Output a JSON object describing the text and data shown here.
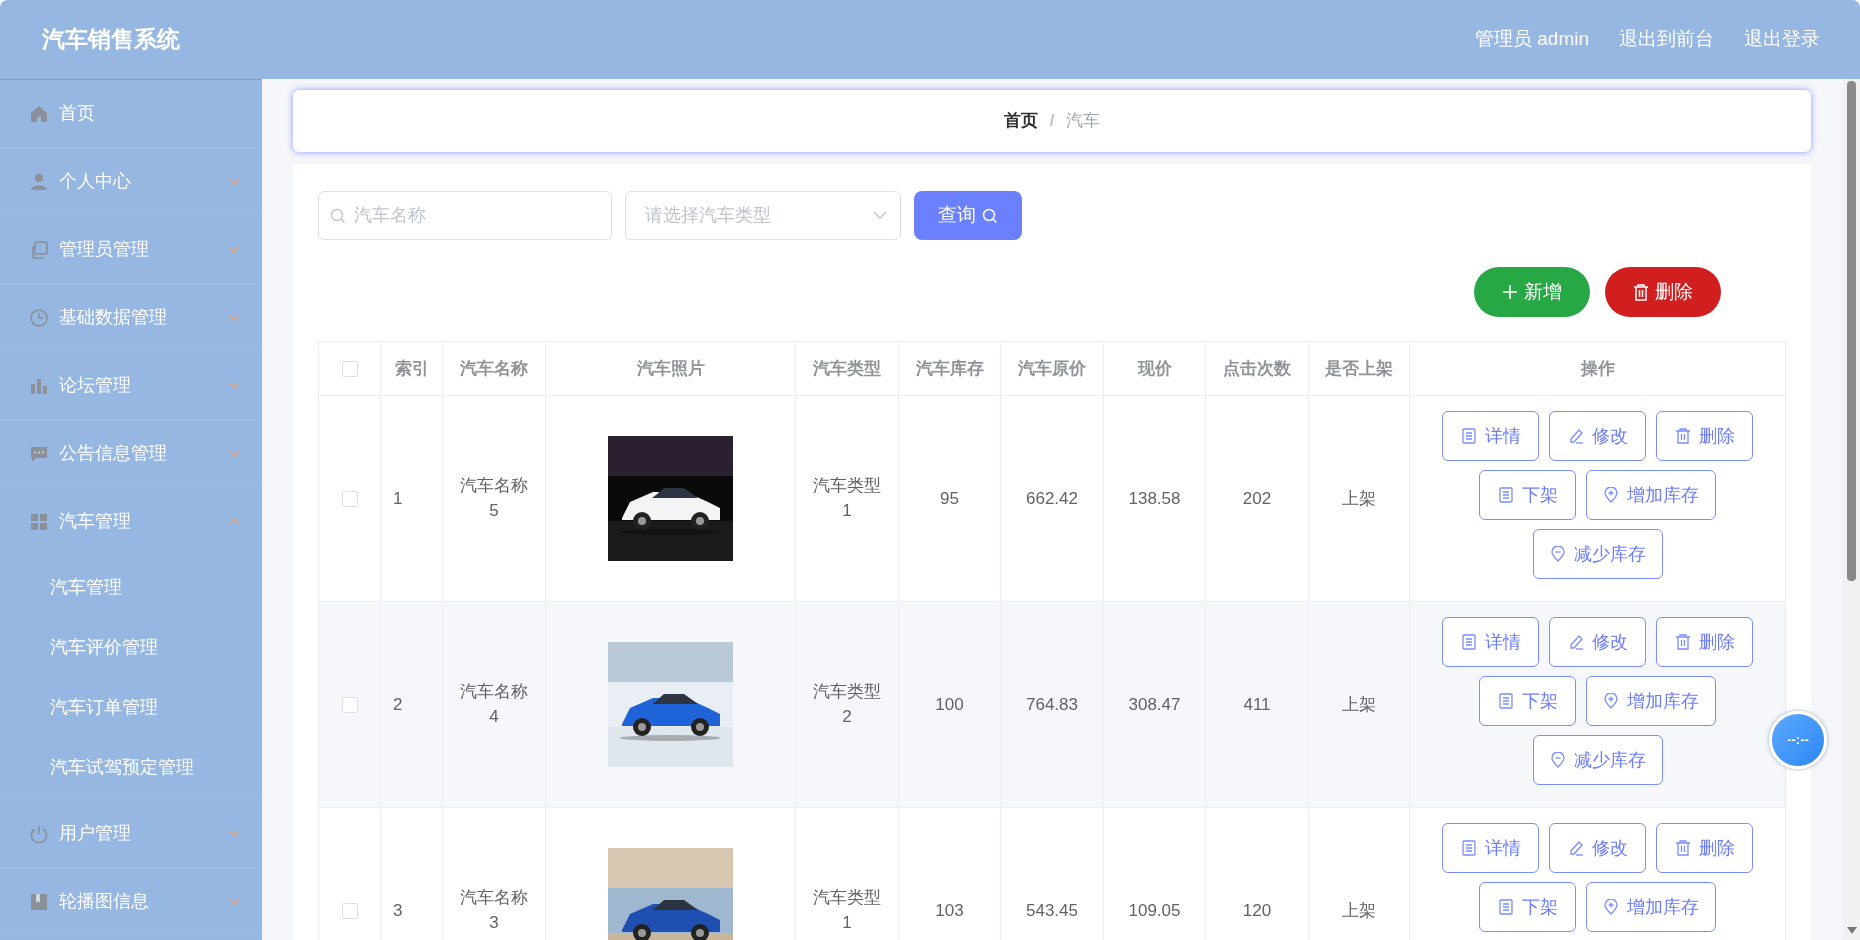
{
  "header": {
    "title": "汽车销售系统",
    "links": [
      "管理员 admin",
      "退出到前台",
      "退出登录"
    ]
  },
  "sidebar": {
    "items": [
      {
        "label": "首页",
        "kind": "link"
      },
      {
        "label": "个人中心",
        "kind": "group",
        "expanded": false
      },
      {
        "label": "管理员管理",
        "kind": "group",
        "expanded": false
      },
      {
        "label": "基础数据管理",
        "kind": "group",
        "expanded": false
      },
      {
        "label": "论坛管理",
        "kind": "group",
        "expanded": false
      },
      {
        "label": "公告信息管理",
        "kind": "group",
        "expanded": false
      },
      {
        "label": "汽车管理",
        "kind": "group",
        "expanded": true,
        "children": [
          {
            "label": "汽车管理"
          },
          {
            "label": "汽车评价管理"
          },
          {
            "label": "汽车订单管理"
          },
          {
            "label": "汽车试驾预定管理"
          }
        ]
      },
      {
        "label": "用户管理",
        "kind": "group",
        "expanded": false
      },
      {
        "label": "轮播图信息",
        "kind": "group",
        "expanded": false
      }
    ]
  },
  "breadcrumb": {
    "separator": "/",
    "items": [
      {
        "label": "首页"
      },
      {
        "label": "汽车"
      }
    ]
  },
  "search": {
    "name_placeholder": "汽车名称",
    "type_placeholder": "请选择汽车类型",
    "button": "查询"
  },
  "toolbar": [
    {
      "label": "新增",
      "kind": "add"
    },
    {
      "label": "删除",
      "kind": "delete"
    }
  ],
  "table": {
    "header_checked": false,
    "columns": [
      "索引",
      "汽车名称",
      "汽车照片",
      "汽车类型",
      "汽车库存",
      "汽车原价",
      "现价",
      "点击次数",
      "是否上架",
      "操作"
    ],
    "rows": [
      {
        "checked": false,
        "index": "1",
        "name": "汽车名称5",
        "photo": {
          "kind": "picture"
        },
        "type": "汽车类型1",
        "stock": "95",
        "price": "662.42",
        "current_price": "138.58",
        "clicks": "202",
        "on_sale": "上架",
        "actions": [
          {
            "kind": "detail",
            "label": "详情"
          },
          {
            "kind": "edit",
            "label": "修改"
          },
          {
            "kind": "delete",
            "label": "删除"
          },
          {
            "kind": "unlist",
            "label": "下架"
          },
          {
            "kind": "add_stock",
            "label": "增加库存"
          },
          {
            "kind": "reduce_stock",
            "label": "减少库存"
          }
        ]
      },
      {
        "checked": false,
        "index": "2",
        "name": "汽车名称4",
        "photo": {
          "kind": "picture"
        },
        "type": "汽车类型2",
        "stock": "100",
        "price": "764.83",
        "current_price": "308.47",
        "clicks": "411",
        "on_sale": "上架",
        "actions": [
          {
            "kind": "detail",
            "label": "详情"
          },
          {
            "kind": "edit",
            "label": "修改"
          },
          {
            "kind": "delete",
            "label": "删除"
          },
          {
            "kind": "unlist",
            "label": "下架"
          },
          {
            "kind": "add_stock",
            "label": "增加库存"
          },
          {
            "kind": "reduce_stock",
            "label": "减少库存"
          }
        ]
      },
      {
        "checked": false,
        "index": "3",
        "name": "汽车名称3",
        "photo": {
          "kind": "picture"
        },
        "type": "汽车类型1",
        "stock": "103",
        "price": "543.45",
        "current_price": "109.05",
        "clicks": "120",
        "on_sale": "上架",
        "actions": [
          {
            "kind": "detail",
            "label": "详情"
          },
          {
            "kind": "edit",
            "label": "修改"
          },
          {
            "kind": "delete",
            "label": "删除"
          },
          {
            "kind": "unlist",
            "label": "下架"
          },
          {
            "kind": "add_stock",
            "label": "增加库存"
          }
        ]
      }
    ]
  },
  "floating_clock": {
    "text": "--:--"
  }
}
